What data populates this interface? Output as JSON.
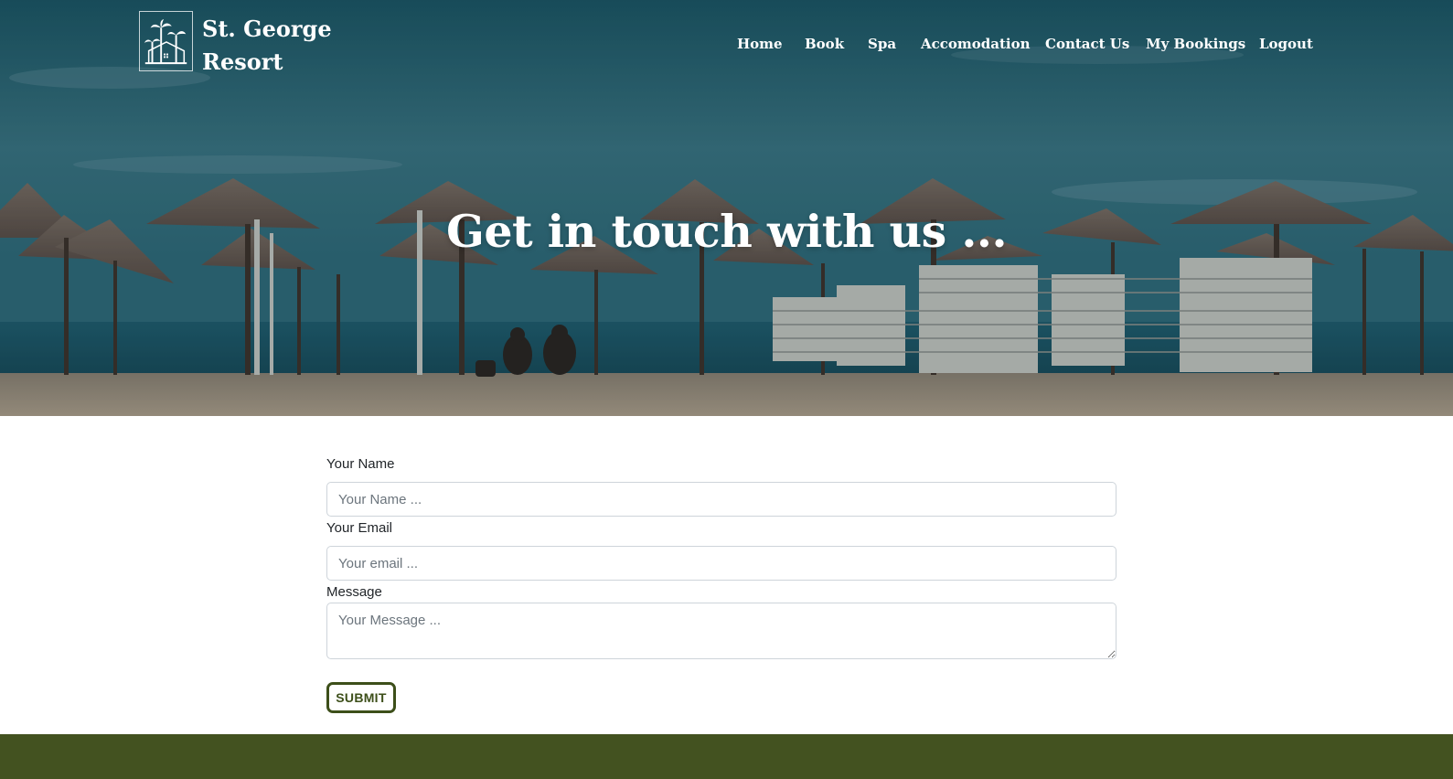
{
  "brand": {
    "name_line1": "St. George",
    "name_line2": "Resort",
    "logo_icon": "palm-house-icon"
  },
  "nav": {
    "items": [
      {
        "label": "Home"
      },
      {
        "label": "Book"
      },
      {
        "label": "Spa"
      },
      {
        "label": "Accomodation"
      },
      {
        "label": "Contact Us"
      },
      {
        "label": "My Bookings"
      },
      {
        "label": "Logout"
      }
    ]
  },
  "hero": {
    "title": "Get in touch with us ..."
  },
  "form": {
    "name_label": "Your Name",
    "name_placeholder": "Your Name ...",
    "name_value": "",
    "email_label": "Your Email",
    "email_placeholder": "Your email ...",
    "email_value": "",
    "message_label": "Message",
    "message_placeholder": "Your Message ...",
    "message_value": "",
    "submit_label": "SUBMIT"
  },
  "colors": {
    "accent": "#3d4f1a",
    "footer": "#435220",
    "hero_overlay": "#1d5563"
  }
}
